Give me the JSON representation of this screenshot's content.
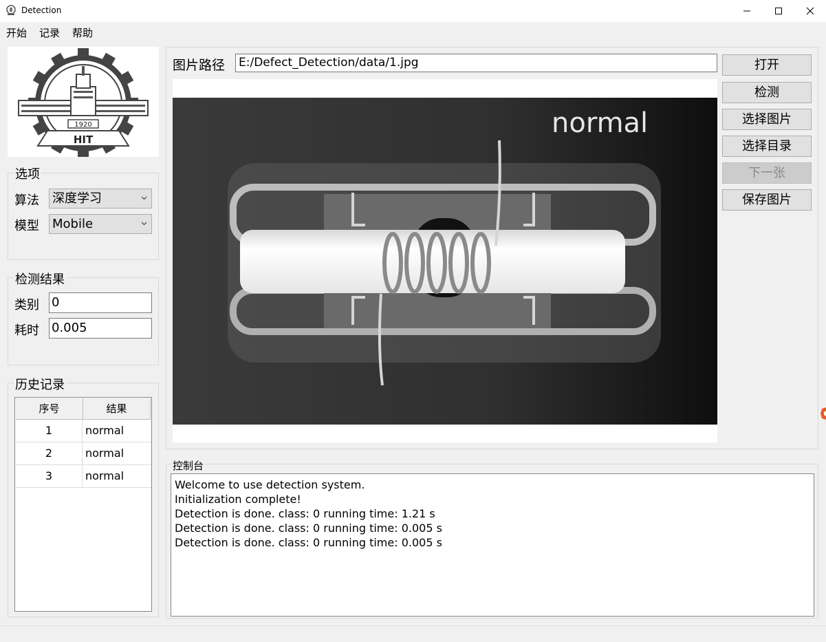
{
  "window": {
    "title": "Detection",
    "icon": "app-logo-icon"
  },
  "menu": {
    "items": [
      "开始",
      "记录",
      "帮助"
    ]
  },
  "logo": {
    "year": "1920",
    "text": "HIT"
  },
  "options": {
    "title": "选项",
    "algorithm_label": "算法",
    "algorithm_value": "深度学习",
    "model_label": "模型",
    "model_value": "Mobile"
  },
  "result": {
    "title": "检测结果",
    "class_label": "类别",
    "class_value": "0",
    "time_label": "耗时",
    "time_value": "0.005"
  },
  "history": {
    "title": "历史记录",
    "columns": [
      "序号",
      "结果"
    ],
    "rows": [
      {
        "idx": "1",
        "result": "normal"
      },
      {
        "idx": "2",
        "result": "normal"
      },
      {
        "idx": "3",
        "result": "normal"
      }
    ]
  },
  "image": {
    "path_label": "图片路径",
    "path_value": "E:/Defect_Detection/data/1.jpg",
    "overlay_label": "normal"
  },
  "buttons": {
    "open": "打开",
    "detect": "检测",
    "select_image": "选择图片",
    "select_dir": "选择目录",
    "next": "下一张",
    "save_image": "保存图片"
  },
  "console": {
    "title": "控制台",
    "lines": [
      "Welcome to use detection system.",
      "Initialization complete!",
      "Detection is done. class: 0 running time: 1.21 s",
      "Detection is done. class: 0 running time: 0.005 s",
      "Detection is done. class: 0 running time: 0.005 s"
    ]
  }
}
